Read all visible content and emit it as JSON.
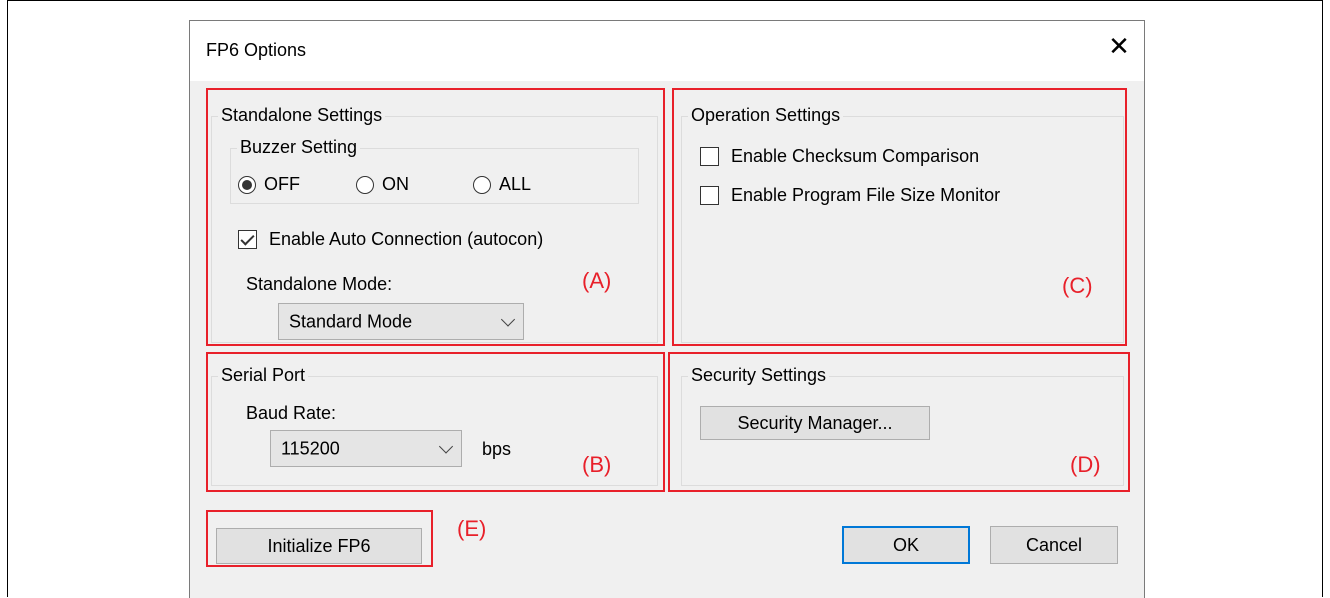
{
  "dialog": {
    "title": "FP6 Options",
    "close_glyph": "✕"
  },
  "standalone": {
    "group_label": "Standalone Settings",
    "buzzer": {
      "group_label": "Buzzer Setting",
      "options": [
        "OFF",
        "ON",
        "ALL"
      ],
      "selected": "OFF"
    },
    "auto_connection": {
      "label": "Enable Auto Connection (autocon)",
      "checked": true
    },
    "mode_label": "Standalone Mode:",
    "mode_value": "Standard Mode"
  },
  "serial_port": {
    "group_label": "Serial Port",
    "baud_label": "Baud Rate:",
    "baud_value": "115200",
    "unit": "bps"
  },
  "operation": {
    "group_label": "Operation Settings",
    "checksum": {
      "label": "Enable Checksum Comparison",
      "checked": false
    },
    "file_size": {
      "label": "Enable Program File Size Monitor",
      "checked": false
    }
  },
  "security": {
    "group_label": "Security Settings",
    "manager_button": "Security Manager..."
  },
  "buttons": {
    "initialize": "Initialize FP6",
    "ok": "OK",
    "cancel": "Cancel"
  },
  "annotations": {
    "a": "(A)",
    "b": "(B)",
    "c": "(C)",
    "d": "(D)",
    "e": "(E)",
    "color": "#e8202a"
  },
  "icons": {
    "close": "close-icon",
    "chevron": "chevron-down-icon",
    "radio": "radio-icon",
    "checkbox": "checkbox-icon"
  }
}
